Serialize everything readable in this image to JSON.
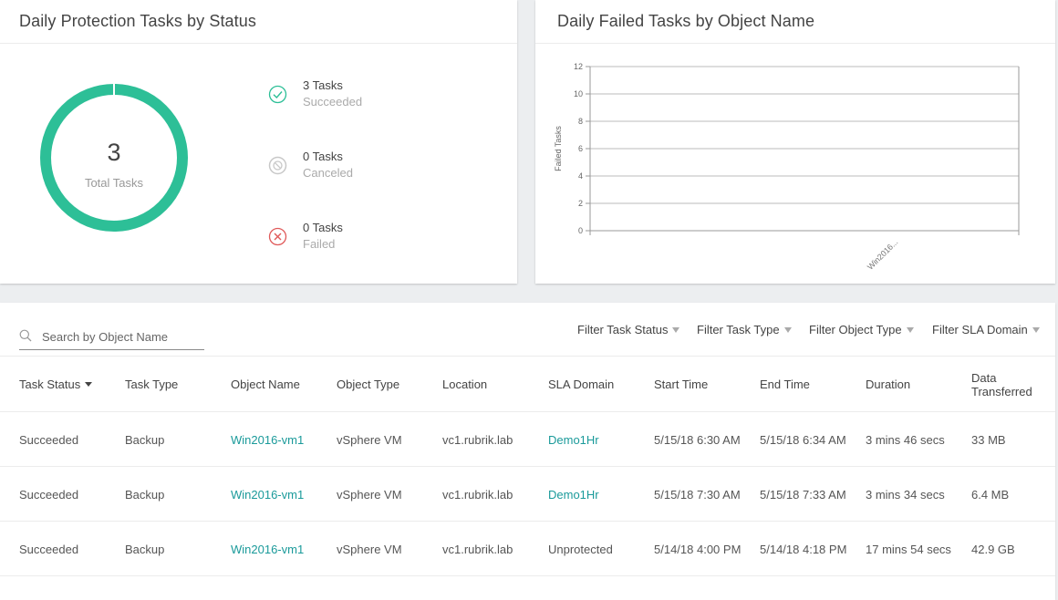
{
  "status_card": {
    "title": "Daily Protection Tasks by Status",
    "total_count": "3",
    "total_label": "Total Tasks",
    "ring_color": "#2dbf97",
    "legend": [
      {
        "count": "3 Tasks",
        "status": "Succeeded",
        "icon": "check-circle-icon",
        "color": "#2dbf97"
      },
      {
        "count": "0 Tasks",
        "status": "Canceled",
        "icon": "canceled-circle-icon",
        "color": "#c8c8c8"
      },
      {
        "count": "0 Tasks",
        "status": "Failed",
        "icon": "x-circle-icon",
        "color": "#e05a5a"
      }
    ]
  },
  "failed_card": {
    "title": "Daily Failed Tasks by Object Name"
  },
  "chart_data": {
    "type": "bar",
    "categories": [
      "Win2016..."
    ],
    "series": [
      {
        "values": [
          0
        ]
      }
    ],
    "ylabel": "Failed Tasks",
    "xlabel": "",
    "ylim": [
      0,
      12
    ],
    "yticks": [
      0,
      2,
      4,
      6,
      8,
      10,
      12
    ],
    "grid": true
  },
  "search": {
    "placeholder": "Search by Object Name",
    "icon": "search-icon"
  },
  "filters": [
    {
      "label": "Filter Task Status"
    },
    {
      "label": "Filter Task Type"
    },
    {
      "label": "Filter Object Type"
    },
    {
      "label": "Filter SLA Domain"
    }
  ],
  "table": {
    "columns": [
      "Task Status",
      "Task Type",
      "Object Name",
      "Object Type",
      "Location",
      "SLA Domain",
      "Start Time",
      "End Time",
      "Duration",
      "Data Transferred"
    ],
    "data_transferred_line1": "Data",
    "data_transferred_line2": "Transferred",
    "link_color": "#1a9a9a",
    "rows": [
      [
        "Succeeded",
        "Backup",
        "Win2016-vm1",
        "vSphere VM",
        "vc1.rubrik.lab",
        "Demo1Hr",
        "5/15/18 6:30 AM",
        "5/15/18 6:34 AM",
        "3 mins 46 secs",
        "33 MB"
      ],
      [
        "Succeeded",
        "Backup",
        "Win2016-vm1",
        "vSphere VM",
        "vc1.rubrik.lab",
        "Demo1Hr",
        "5/15/18 7:30 AM",
        "5/15/18 7:33 AM",
        "3 mins 34 secs",
        "6.4 MB"
      ],
      [
        "Succeeded",
        "Backup",
        "Win2016-vm1",
        "vSphere VM",
        "vc1.rubrik.lab",
        "Unprotected",
        "5/14/18 4:00 PM",
        "5/14/18 4:18 PM",
        "17 mins 54 secs",
        "42.9 GB"
      ]
    ]
  }
}
